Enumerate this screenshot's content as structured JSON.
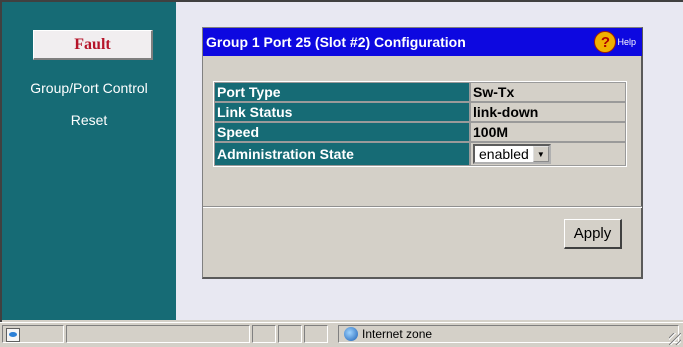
{
  "nav": {
    "items": [
      {
        "label": "Fault"
      },
      {
        "label": "Group/Port Control"
      },
      {
        "label": "Reset"
      }
    ]
  },
  "panel": {
    "title": "Group 1 Port 25 (Slot #2) Configuration",
    "help_label": "Help",
    "help_symbol": "?",
    "rows": [
      {
        "label": "Port Type",
        "value": "Sw-Tx"
      },
      {
        "label": "Link Status",
        "value": "link-down"
      },
      {
        "label": "Speed",
        "value": "100M"
      },
      {
        "label": "Administration State",
        "value": "enabled"
      }
    ],
    "apply_label": "Apply"
  },
  "status": {
    "zone": "Internet zone"
  },
  "colors": {
    "nav_bg": "#166b75",
    "title_bar": "#0d08e0",
    "fault_text": "#b5142a",
    "content_bg": "#e8e8f2"
  }
}
